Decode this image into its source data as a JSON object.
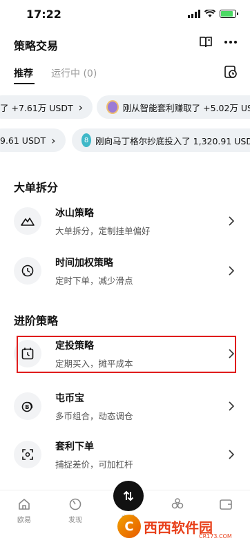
{
  "status_bar": {
    "time": "17:22"
  },
  "header": {
    "title": "策略交易"
  },
  "tabs": [
    {
      "label": "推荐",
      "active": true
    },
    {
      "label": "运行中 (0)",
      "active": false
    }
  ],
  "ticker": {
    "row1": [
      {
        "text": "了 +7.61万 USDT",
        "chevron": "›"
      },
      {
        "text": "刚从智能套利赚取了 +5.02万 US",
        "coin": "purple"
      }
    ],
    "row2": [
      {
        "text": "9.61 USDT",
        "chevron": "›"
      },
      {
        "text": "刚向马丁格尔抄底投入了 1,320.91 USD",
        "coin_label": "8"
      }
    ]
  },
  "sections": [
    {
      "title": "大单拆分",
      "items": [
        {
          "title": "冰山策略",
          "subtitle": "大单拆分，定制挂单偏好",
          "icon": "mountain-icon"
        },
        {
          "title": "时间加权策略",
          "subtitle": "定时下单，减少滑点",
          "icon": "clock-icon"
        }
      ]
    },
    {
      "title": "进阶策略",
      "items": [
        {
          "title": "定投策略",
          "subtitle": "定期买入，摊平成本",
          "icon": "calendar-clock-icon"
        },
        {
          "title": "屯币宝",
          "subtitle": "多币组合，动态调仓",
          "icon": "coin-stack-icon"
        },
        {
          "title": "套利下单",
          "subtitle": "捕捉差价，可加杠杆",
          "icon": "arbitrage-icon"
        }
      ]
    }
  ],
  "bottom_nav": {
    "items": [
      {
        "label": "欧易",
        "icon": "home-icon"
      },
      {
        "label": "发现",
        "icon": "discover-icon"
      },
      {
        "label": "交易",
        "icon": "trade-icon"
      },
      {
        "label": "",
        "icon": "earn-icon"
      },
      {
        "label": "",
        "icon": "wallet-icon"
      }
    ]
  },
  "watermark": {
    "logo": "C",
    "text": "西西软件园",
    "sub": "CR173.COM"
  },
  "colors": {
    "highlight": "#e01c1c",
    "pill_bg": "#eef1f4",
    "fab": "#111111"
  }
}
